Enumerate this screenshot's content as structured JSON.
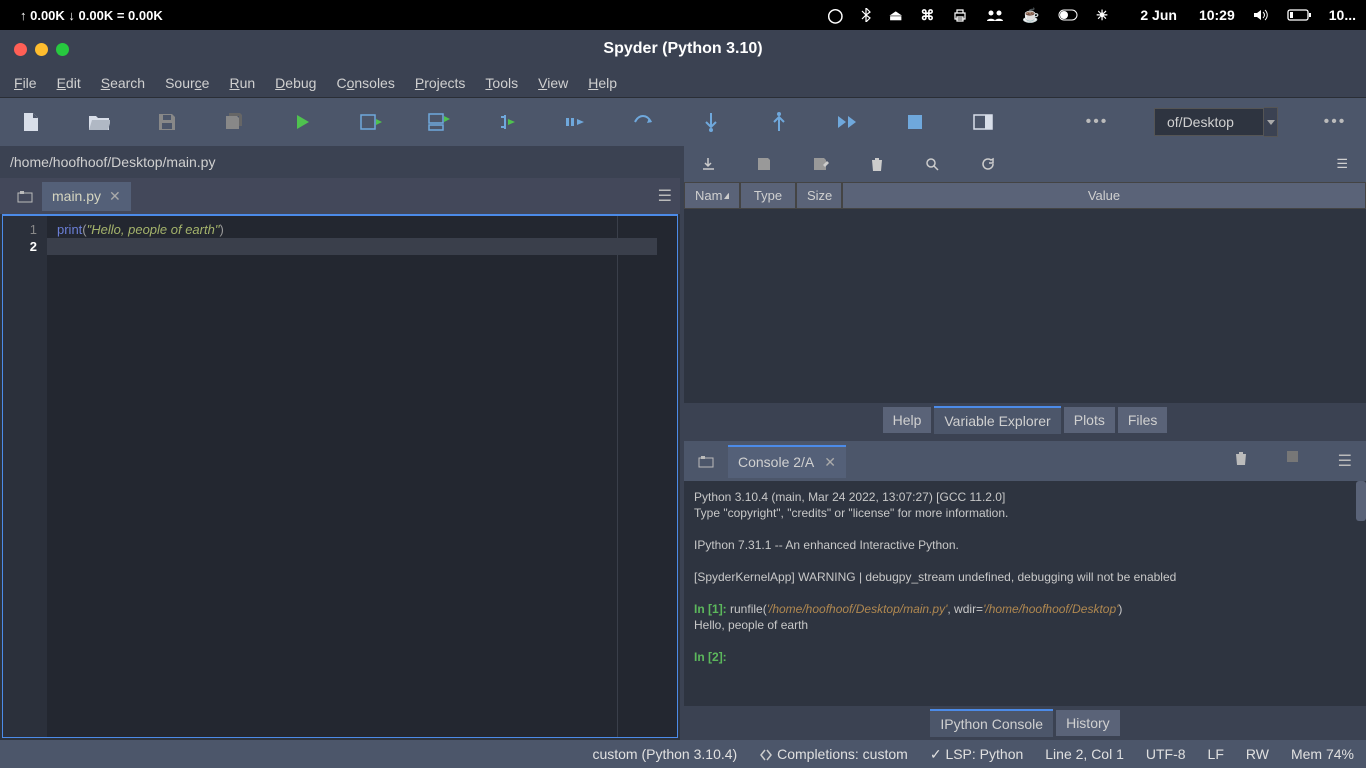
{
  "macbar": {
    "net": "↑ 0.00K ↓ 0.00K = 0.00K",
    "date": "2 Jun",
    "time": "10:29",
    "battery": "10..."
  },
  "window": {
    "title": "Spyder (Python 3.10)"
  },
  "menu": [
    "File",
    "Edit",
    "Search",
    "Source",
    "Run",
    "Debug",
    "Consoles",
    "Projects",
    "Tools",
    "View",
    "Help"
  ],
  "toolbar": {
    "workdir": "of/Desktop"
  },
  "editor": {
    "path": "/home/hoofhoof/Desktop/main.py",
    "tab": "main.py",
    "lines": [
      {
        "n": "1",
        "tokens": [
          [
            "f",
            "print"
          ],
          [
            "p",
            "("
          ],
          [
            "s",
            "\"Hello, people of earth\""
          ],
          [
            "p",
            ")"
          ]
        ]
      },
      {
        "n": "2",
        "tokens": []
      }
    ],
    "current_line": 2
  },
  "var_explorer": {
    "cols": [
      "Nam",
      "Type",
      "Size",
      "Value"
    ],
    "tabs": [
      "Help",
      "Variable Explorer",
      "Plots",
      "Files"
    ],
    "active_tab": 1
  },
  "console": {
    "tab": "Console 2/A",
    "banner1": "Python 3.10.4 (main, Mar 24 2022, 13:07:27) [GCC 11.2.0]",
    "banner2": "Type \"copyright\", \"credits\" or \"license\" for more information.",
    "banner3": "IPython 7.31.1 -- An enhanced Interactive Python.",
    "warn": "[SpyderKernelApp] WARNING | debugpy_stream undefined, debugging will not be enabled",
    "in1_pre": "In [",
    "in1_n": "1",
    "in1_post": "]: ",
    "run_cmd": "runfile(",
    "run_path": "'/home/hoofhoof/Desktop/main.py'",
    "run_mid": ", wdir=",
    "run_wdir": "'/home/hoofhoof/Desktop'",
    "run_end": ")",
    "output": "Hello, people of earth",
    "in2_pre": "In [",
    "in2_n": "2",
    "in2_post": "]: ",
    "tabs": [
      "IPython Console",
      "History"
    ],
    "active_tab": 0
  },
  "status": {
    "interpreter": "custom (Python 3.10.4)",
    "completions": "Completions: custom",
    "lsp": "LSP: Python",
    "cursor": "Line 2, Col 1",
    "encoding": "UTF-8",
    "eol": "LF",
    "perm": "RW",
    "mem": "Mem 74%"
  }
}
